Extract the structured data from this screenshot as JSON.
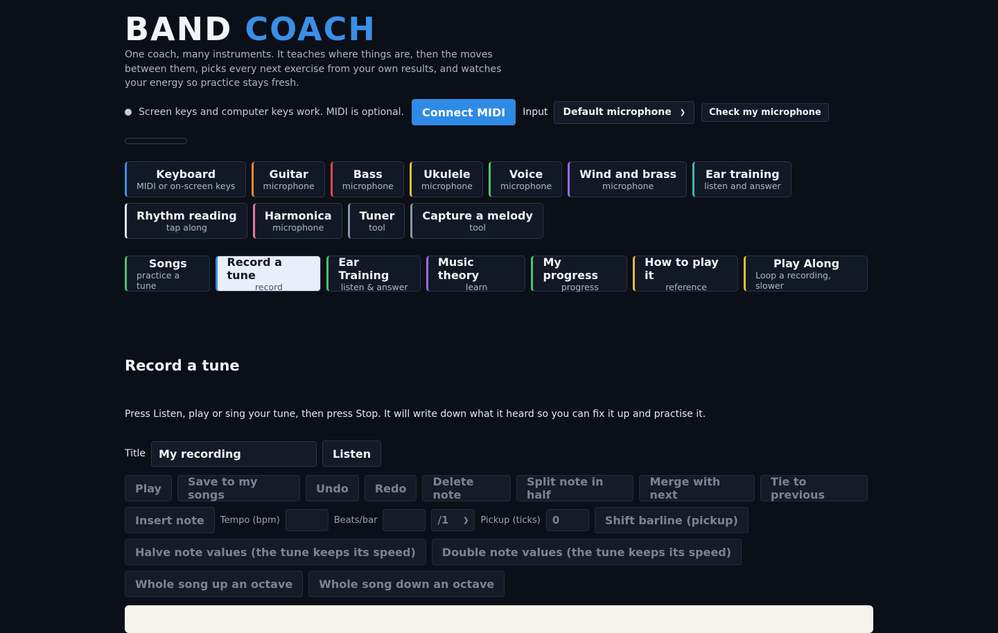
{
  "header": {
    "title_part1": "BAND",
    "title_part2": "COACH",
    "tagline": "One coach, many instruments. It teaches where things are, then the moves between them, picks every next exercise from your own results, and watches your energy so practice stays fresh."
  },
  "midi": {
    "status_text": "Screen keys and computer keys work. MIDI is optional.",
    "connect_label": "Connect MIDI",
    "input_label": "Input",
    "input_selected": "Default microphone",
    "check_label": "Check my microphone"
  },
  "instruments": [
    {
      "title": "Keyboard",
      "sub": "MIDI or on-screen keys",
      "color": "#3a8fe6"
    },
    {
      "title": "Guitar",
      "sub": "microphone",
      "color": "#e68a2e"
    },
    {
      "title": "Bass",
      "sub": "microphone",
      "color": "#e04848"
    },
    {
      "title": "Ukulele",
      "sub": "microphone",
      "color": "#e6c02e"
    },
    {
      "title": "Voice",
      "sub": "microphone",
      "color": "#4cc46a"
    },
    {
      "title": "Wind and brass",
      "sub": "microphone",
      "color": "#9a6be6"
    },
    {
      "title": "Ear training",
      "sub": "listen and answer",
      "color": "#3ab8b0"
    },
    {
      "title": "Rhythm reading",
      "sub": "tap along",
      "color": "#e6e9ef"
    },
    {
      "title": "Harmonica",
      "sub": "microphone",
      "color": "#e67aa6"
    },
    {
      "title": "Tuner",
      "sub": "tool",
      "color": "#8a94a8"
    },
    {
      "title": "Capture a melody",
      "sub": "tool",
      "color": "#8a94a8"
    }
  ],
  "modes": [
    {
      "title": "Songs",
      "sub": "practice a tune",
      "color": "#4cc46a"
    },
    {
      "title": "Record a tune",
      "sub": "record",
      "color": "#3a8fe6"
    },
    {
      "title": "Ear Training",
      "sub": "listen & answer",
      "color": "#4cc46a"
    },
    {
      "title": "Music theory",
      "sub": "learn",
      "color": "#9a6be6"
    },
    {
      "title": "My progress",
      "sub": "progress",
      "color": "#4cc46a"
    },
    {
      "title": "How to play it",
      "sub": "reference",
      "color": "#e6c02e"
    },
    {
      "title": "Play Along",
      "sub": "Loop a recording, slower",
      "color": "#e6c02e"
    }
  ],
  "section": {
    "title": "Record a tune",
    "description": "Press Listen, play or sing your tune, then press Stop. It will write down what it heard so you can fix it up and practise it.",
    "title_label": "Title",
    "title_value": "My recording",
    "listen_label": "Listen"
  },
  "edit": {
    "play": "Play",
    "save": "Save to my songs",
    "undo": "Undo",
    "redo": "Redo",
    "delete": "Delete note",
    "split": "Split note in half",
    "merge": "Merge with next",
    "tie": "Tie to previous",
    "insert": "Insert note",
    "tempo_label": "Tempo (bpm)",
    "beats_label": "Beats/bar",
    "beat_unit": "/1",
    "pickup_label": "Pickup (ticks)",
    "pickup_value": "0",
    "shift": "Shift barline (pickup)",
    "halve": "Halve note values (the tune keeps its speed)",
    "double": "Double note values (the tune keeps its speed)",
    "octave_up": "Whole song up an octave",
    "octave_down": "Whole song down an octave"
  }
}
